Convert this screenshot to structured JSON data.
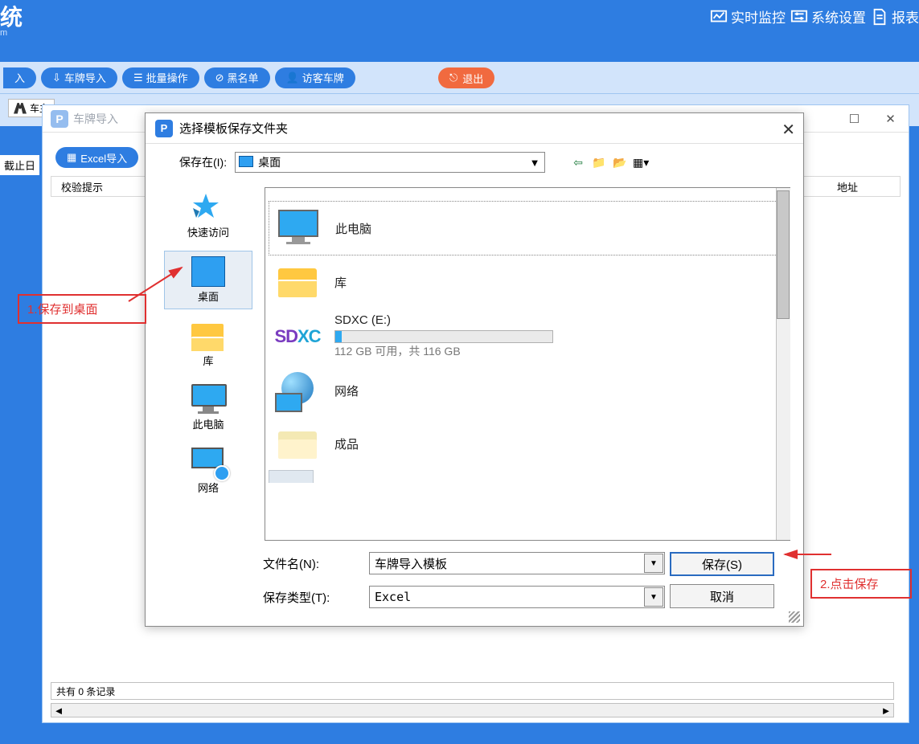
{
  "header": {
    "logo_text": "统",
    "logo_sub": "m",
    "right_buttons": {
      "monitor": "实时监控",
      "settings": "系统设置",
      "reports": "报表"
    }
  },
  "toolbar": {
    "item1": "入",
    "plate_import": "车牌导入",
    "batch_ops": "批量操作",
    "blacklist": "黑名单",
    "visitor_plate": "访客车牌",
    "exit": "退出"
  },
  "searchbar": {
    "owner_label": "车主"
  },
  "main": {
    "cutoff_label": "截止日",
    "col_header": "校验提示",
    "col_address": "地址",
    "status_bar": "共有 0 条记录"
  },
  "subwin": {
    "title": "车牌导入",
    "excel_btn": "Excel导入"
  },
  "dialog": {
    "title": "选择模板保存文件夹",
    "save_in_label": "保存在(I):",
    "save_in_value": "桌面",
    "places": {
      "quick_access": "快速访问",
      "desktop": "桌面",
      "library": "库",
      "this_pc": "此电脑",
      "network": "网络"
    },
    "items": {
      "this_pc": "此电脑",
      "library": "库",
      "sdxc_name": "SDXC (E:)",
      "sdxc_sub": "112 GB 可用，共 116 GB",
      "network": "网络",
      "product": "成品"
    },
    "filename_label": "文件名(N):",
    "filename_value": "车牌导入模板",
    "filetype_label": "保存类型(T):",
    "filetype_value": "Excel",
    "save_btn": "保存(S)",
    "cancel_btn": "取消"
  },
  "annotations": {
    "step1": "1.保存到桌面",
    "step2": "2.点击保存"
  }
}
